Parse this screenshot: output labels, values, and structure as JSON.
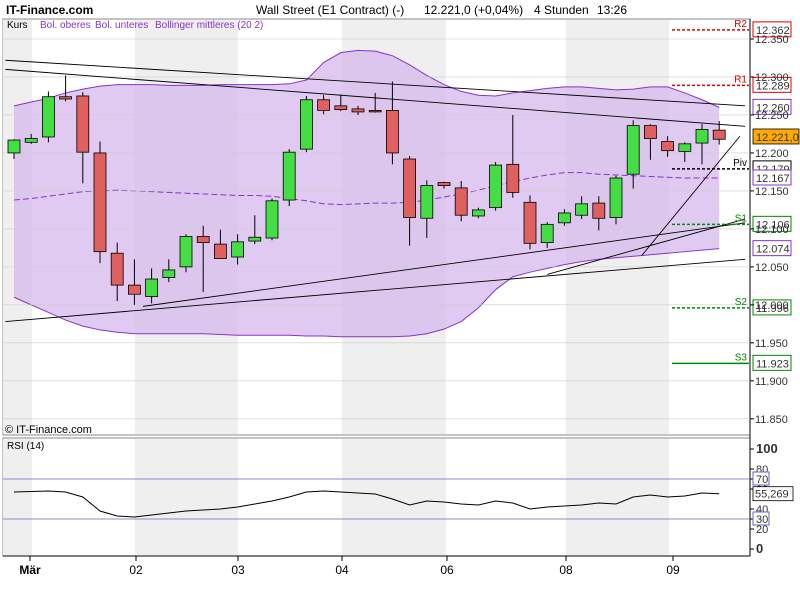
{
  "header": {
    "site": "IT-Finance.com",
    "instrument": "Wall Street (E1 Contract) (-)",
    "price_change": "12.221,0 (+0,04%)",
    "interval": "4 Stunden",
    "time": "13:26"
  },
  "main_panel": {
    "label": "Kurs",
    "legend": {
      "upper": "Bol. oberes",
      "lower": "Bol. unteres",
      "middle": "Bollinger mittleres (20 2)"
    },
    "watermark": "© IT-Finance.com"
  },
  "rsi_panel": {
    "label": "RSI (14)",
    "value_label": "55,269",
    "ticks": [
      "100",
      "80",
      "70",
      "60",
      "40",
      "30",
      "20",
      "0"
    ]
  },
  "colors": {
    "bull": "#44dd44",
    "bear": "#e06060",
    "band_fill": "#d6b8ee",
    "band_line": "#8833cc",
    "resistance": "#dd0000",
    "support": "#008800",
    "pivot": "#000000",
    "current": "#ffaa00"
  },
  "chart_data": {
    "type": "candlestick",
    "ylim": [
      11.83,
      12.375
    ],
    "y_ticks": [
      "12.350",
      "12.300",
      "12.250",
      "12.200",
      "12.150",
      "12.100",
      "12.050",
      "12.000",
      "11.950",
      "11.900",
      "11.850"
    ],
    "x_labels": [
      "Mär",
      "02",
      "03",
      "04",
      "06",
      "08",
      "09"
    ],
    "candles": [
      {
        "o": 12.2,
        "h": 12.218,
        "l": 12.192,
        "c": 12.217
      },
      {
        "o": 12.214,
        "h": 12.225,
        "l": 12.212,
        "c": 12.219
      },
      {
        "o": 12.221,
        "h": 12.281,
        "l": 12.214,
        "c": 12.274
      },
      {
        "o": 12.274,
        "h": 12.302,
        "l": 12.268,
        "c": 12.271
      },
      {
        "o": 12.275,
        "h": 12.28,
        "l": 12.16,
        "c": 12.201
      },
      {
        "o": 12.2,
        "h": 12.215,
        "l": 12.055,
        "c": 12.07
      },
      {
        "o": 12.068,
        "h": 12.082,
        "l": 12.005,
        "c": 12.026
      },
      {
        "o": 12.026,
        "h": 12.06,
        "l": 12.0,
        "c": 12.014
      },
      {
        "o": 12.011,
        "h": 12.048,
        "l": 12.002,
        "c": 12.034
      },
      {
        "o": 12.036,
        "h": 12.06,
        "l": 12.03,
        "c": 12.046
      },
      {
        "o": 12.05,
        "h": 12.093,
        "l": 12.043,
        "c": 12.09
      },
      {
        "o": 12.09,
        "h": 12.104,
        "l": 12.017,
        "c": 12.082
      },
      {
        "o": 12.08,
        "h": 12.099,
        "l": 12.061,
        "c": 12.061
      },
      {
        "o": 12.063,
        "h": 12.093,
        "l": 12.053,
        "c": 12.083
      },
      {
        "o": 12.084,
        "h": 12.118,
        "l": 12.08,
        "c": 12.089
      },
      {
        "o": 12.088,
        "h": 12.14,
        "l": 12.085,
        "c": 12.137
      },
      {
        "o": 12.138,
        "h": 12.205,
        "l": 12.13,
        "c": 12.201
      },
      {
        "o": 12.205,
        "h": 12.275,
        "l": 12.201,
        "c": 12.27
      },
      {
        "o": 12.27,
        "h": 12.276,
        "l": 12.251,
        "c": 12.256
      },
      {
        "o": 12.262,
        "h": 12.277,
        "l": 12.255,
        "c": 12.257
      },
      {
        "o": 12.258,
        "h": 12.262,
        "l": 12.25,
        "c": 12.254
      },
      {
        "o": 12.256,
        "h": 12.279,
        "l": 12.253,
        "c": 12.255
      },
      {
        "o": 12.256,
        "h": 12.294,
        "l": 12.185,
        "c": 12.2
      },
      {
        "o": 12.192,
        "h": 12.196,
        "l": 12.078,
        "c": 12.115
      },
      {
        "o": 12.114,
        "h": 12.164,
        "l": 12.088,
        "c": 12.157
      },
      {
        "o": 12.161,
        "h": 12.162,
        "l": 12.153,
        "c": 12.157
      },
      {
        "o": 12.154,
        "h": 12.163,
        "l": 12.11,
        "c": 12.118
      },
      {
        "o": 12.117,
        "h": 12.128,
        "l": 12.114,
        "c": 12.125
      },
      {
        "o": 12.128,
        "h": 12.188,
        "l": 12.124,
        "c": 12.184
      },
      {
        "o": 12.185,
        "h": 12.25,
        "l": 12.141,
        "c": 12.148
      },
      {
        "o": 12.135,
        "h": 12.144,
        "l": 12.073,
        "c": 12.081
      },
      {
        "o": 12.082,
        "h": 12.109,
        "l": 12.075,
        "c": 12.106
      },
      {
        "o": 12.108,
        "h": 12.126,
        "l": 12.104,
        "c": 12.121
      },
      {
        "o": 12.118,
        "h": 12.143,
        "l": 12.113,
        "c": 12.133
      },
      {
        "o": 12.134,
        "h": 12.143,
        "l": 12.098,
        "c": 12.114
      },
      {
        "o": 12.115,
        "h": 12.17,
        "l": 12.106,
        "c": 12.167
      },
      {
        "o": 12.172,
        "h": 12.243,
        "l": 12.153,
        "c": 12.236
      },
      {
        "o": 12.236,
        "h": 12.238,
        "l": 12.191,
        "c": 12.219
      },
      {
        "o": 12.215,
        "h": 12.222,
        "l": 12.195,
        "c": 12.203
      },
      {
        "o": 12.202,
        "h": 12.214,
        "l": 12.188,
        "c": 12.212
      },
      {
        "o": 12.213,
        "h": 12.238,
        "l": 12.185,
        "c": 12.231
      },
      {
        "o": 12.23,
        "h": 12.242,
        "l": 12.211,
        "c": 12.218
      }
    ],
    "bollinger": {
      "upper": [
        12.262,
        12.267,
        12.272,
        12.279,
        12.284,
        12.288,
        12.29,
        12.29,
        12.29,
        12.289,
        12.289,
        12.289,
        12.29,
        12.29,
        12.29,
        12.29,
        12.291,
        12.296,
        12.319,
        12.332,
        12.335,
        12.334,
        12.328,
        12.316,
        12.302,
        12.29,
        12.281,
        12.276,
        12.275,
        12.279,
        12.282,
        12.285,
        12.287,
        12.287,
        12.285,
        12.283,
        12.284,
        12.287,
        12.287,
        12.279,
        12.27,
        12.26
      ],
      "middle": [
        12.138,
        12.14,
        12.143,
        12.146,
        12.149,
        12.15,
        12.151,
        12.15,
        12.149,
        12.148,
        12.147,
        12.146,
        12.145,
        12.144,
        12.144,
        12.143,
        12.14,
        12.137,
        12.133,
        12.132,
        12.133,
        12.134,
        12.134,
        12.135,
        12.138,
        12.142,
        12.146,
        12.151,
        12.157,
        12.162,
        12.167,
        12.171,
        12.174,
        12.174,
        12.172,
        12.171,
        12.17,
        12.169,
        12.168,
        12.167,
        12.167,
        12.167
      ],
      "lower": [
        12.01,
        12.0,
        11.99,
        11.98,
        11.972,
        11.967,
        11.964,
        11.962,
        11.962,
        11.962,
        11.962,
        11.962,
        11.961,
        11.96,
        11.96,
        11.96,
        11.96,
        11.959,
        11.959,
        11.958,
        11.958,
        11.958,
        11.958,
        11.959,
        11.962,
        11.968,
        11.978,
        11.996,
        12.02,
        12.037,
        12.043,
        12.048,
        12.053,
        12.057,
        12.06,
        12.062,
        12.064,
        12.066,
        12.068,
        12.07,
        12.072,
        12.074
      ]
    },
    "levels": [
      {
        "label": "R2",
        "value": 12.362,
        "text": "12.362",
        "kind": "resistance",
        "style": "dashed"
      },
      {
        "label": "R1",
        "value": 12.289,
        "text": "12.289",
        "kind": "resistance",
        "style": "dashed"
      },
      {
        "label": "Piv",
        "value": 12.179,
        "text": "12.179",
        "kind": "pivot",
        "style": "dashed"
      },
      {
        "label": "S1",
        "value": 12.106,
        "text": "12.106",
        "kind": "support",
        "style": "dashed"
      },
      {
        "label": "S2",
        "value": 11.996,
        "text": "11.996",
        "kind": "support",
        "style": "dashed"
      },
      {
        "label": "S3",
        "value": 11.923,
        "text": "11.923",
        "kind": "support",
        "style": "solid"
      }
    ],
    "right_labels": [
      {
        "value": 12.26,
        "text": "12.260",
        "color": "#8833cc"
      },
      {
        "value": 12.221,
        "text": "12.221,0",
        "color": "#000000",
        "bg": "#ffaa00"
      },
      {
        "value": 12.167,
        "text": "12.167",
        "color": "#8833cc"
      },
      {
        "value": 12.074,
        "text": "12.074",
        "color": "#8833cc"
      }
    ],
    "trendlines": [
      {
        "x1": -0.5,
        "y1": 12.322,
        "x2": 42.5,
        "y2": 12.262
      },
      {
        "x1": -0.5,
        "y1": 12.31,
        "x2": 42.5,
        "y2": 12.235
      },
      {
        "x1": -0.5,
        "y1": 11.978,
        "x2": 42.5,
        "y2": 12.06
      },
      {
        "x1": 7.5,
        "y1": 11.998,
        "x2": 42.5,
        "y2": 12.108
      },
      {
        "x1": 31.0,
        "y1": 12.04,
        "x2": 42.5,
        "y2": 12.113
      },
      {
        "x1": 36.5,
        "y1": 12.065,
        "x2": 42.2,
        "y2": 12.222
      }
    ],
    "rsi": {
      "ylim": [
        0,
        100
      ],
      "levels": [
        70,
        30
      ],
      "values": [
        57,
        57.5,
        58,
        57,
        52,
        38,
        33,
        32,
        34,
        36,
        38,
        39,
        40,
        42,
        45,
        48,
        52,
        57,
        58,
        57,
        56,
        55,
        50,
        44,
        48,
        47,
        45,
        44,
        48,
        46,
        40,
        42,
        43,
        44,
        46,
        45,
        52,
        54,
        52,
        53,
        56,
        55.3
      ]
    }
  }
}
